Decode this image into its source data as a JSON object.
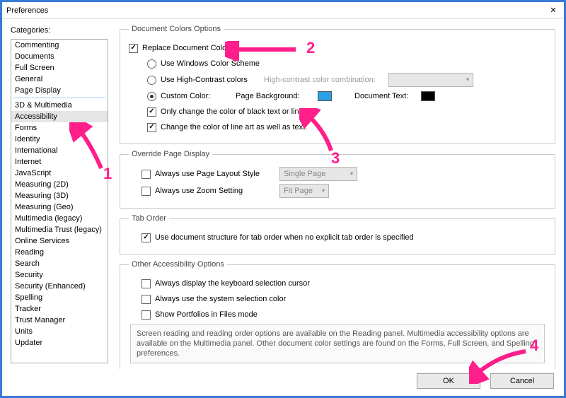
{
  "window": {
    "title": "Preferences"
  },
  "sidebar": {
    "label": "Categories:",
    "group1": [
      "Commenting",
      "Documents",
      "Full Screen",
      "General",
      "Page Display"
    ],
    "group2": [
      "3D & Multimedia",
      "Accessibility",
      "Forms",
      "Identity",
      "International",
      "Internet",
      "JavaScript",
      "Measuring (2D)",
      "Measuring (3D)",
      "Measuring (Geo)",
      "Multimedia (legacy)",
      "Multimedia Trust (legacy)",
      "Online Services",
      "Reading",
      "Search",
      "Security",
      "Security (Enhanced)",
      "Spelling",
      "Tracker",
      "Trust Manager",
      "Units",
      "Updater"
    ],
    "selected": "Accessibility"
  },
  "doc_colors": {
    "legend": "Document Colors Options",
    "replace": "Replace Document Colors",
    "win_scheme": "Use Windows Color Scheme",
    "high_contrast": "Use High-Contrast colors",
    "hc_combo_label": "High-contrast color combination:",
    "custom": "Custom Color:",
    "page_bg_label": "Page Background:",
    "doc_text_label": "Document Text:",
    "page_bg_color": "#2aa0e6",
    "doc_text_color": "#000000",
    "only_black": "Only change the color of black text or line art.",
    "line_art": "Change the color of line art as well as text."
  },
  "override": {
    "legend": "Override Page Display",
    "layout": "Always use Page Layout Style",
    "layout_val": "Single Page",
    "zoom": "Always use Zoom Setting",
    "zoom_val": "Fit Page"
  },
  "tab_order": {
    "legend": "Tab Order",
    "use_doc": "Use document structure for tab order when no explicit tab order is specified"
  },
  "other": {
    "legend": "Other Accessibility Options",
    "kb_cursor": "Always display the keyboard selection cursor",
    "sys_sel": "Always use the system selection color",
    "portfolios": "Show Portfolios in Files mode",
    "info": "Screen reading and reading order options are available on the Reading panel. Multimedia accessibility options are available on the Multimedia panel. Other document color settings are found on the Forms, Full Screen, and Spelling preferences."
  },
  "buttons": {
    "ok": "OK",
    "cancel": "Cancel"
  },
  "annot": {
    "n1": "1",
    "n2": "2",
    "n3": "3",
    "n4": "4"
  }
}
